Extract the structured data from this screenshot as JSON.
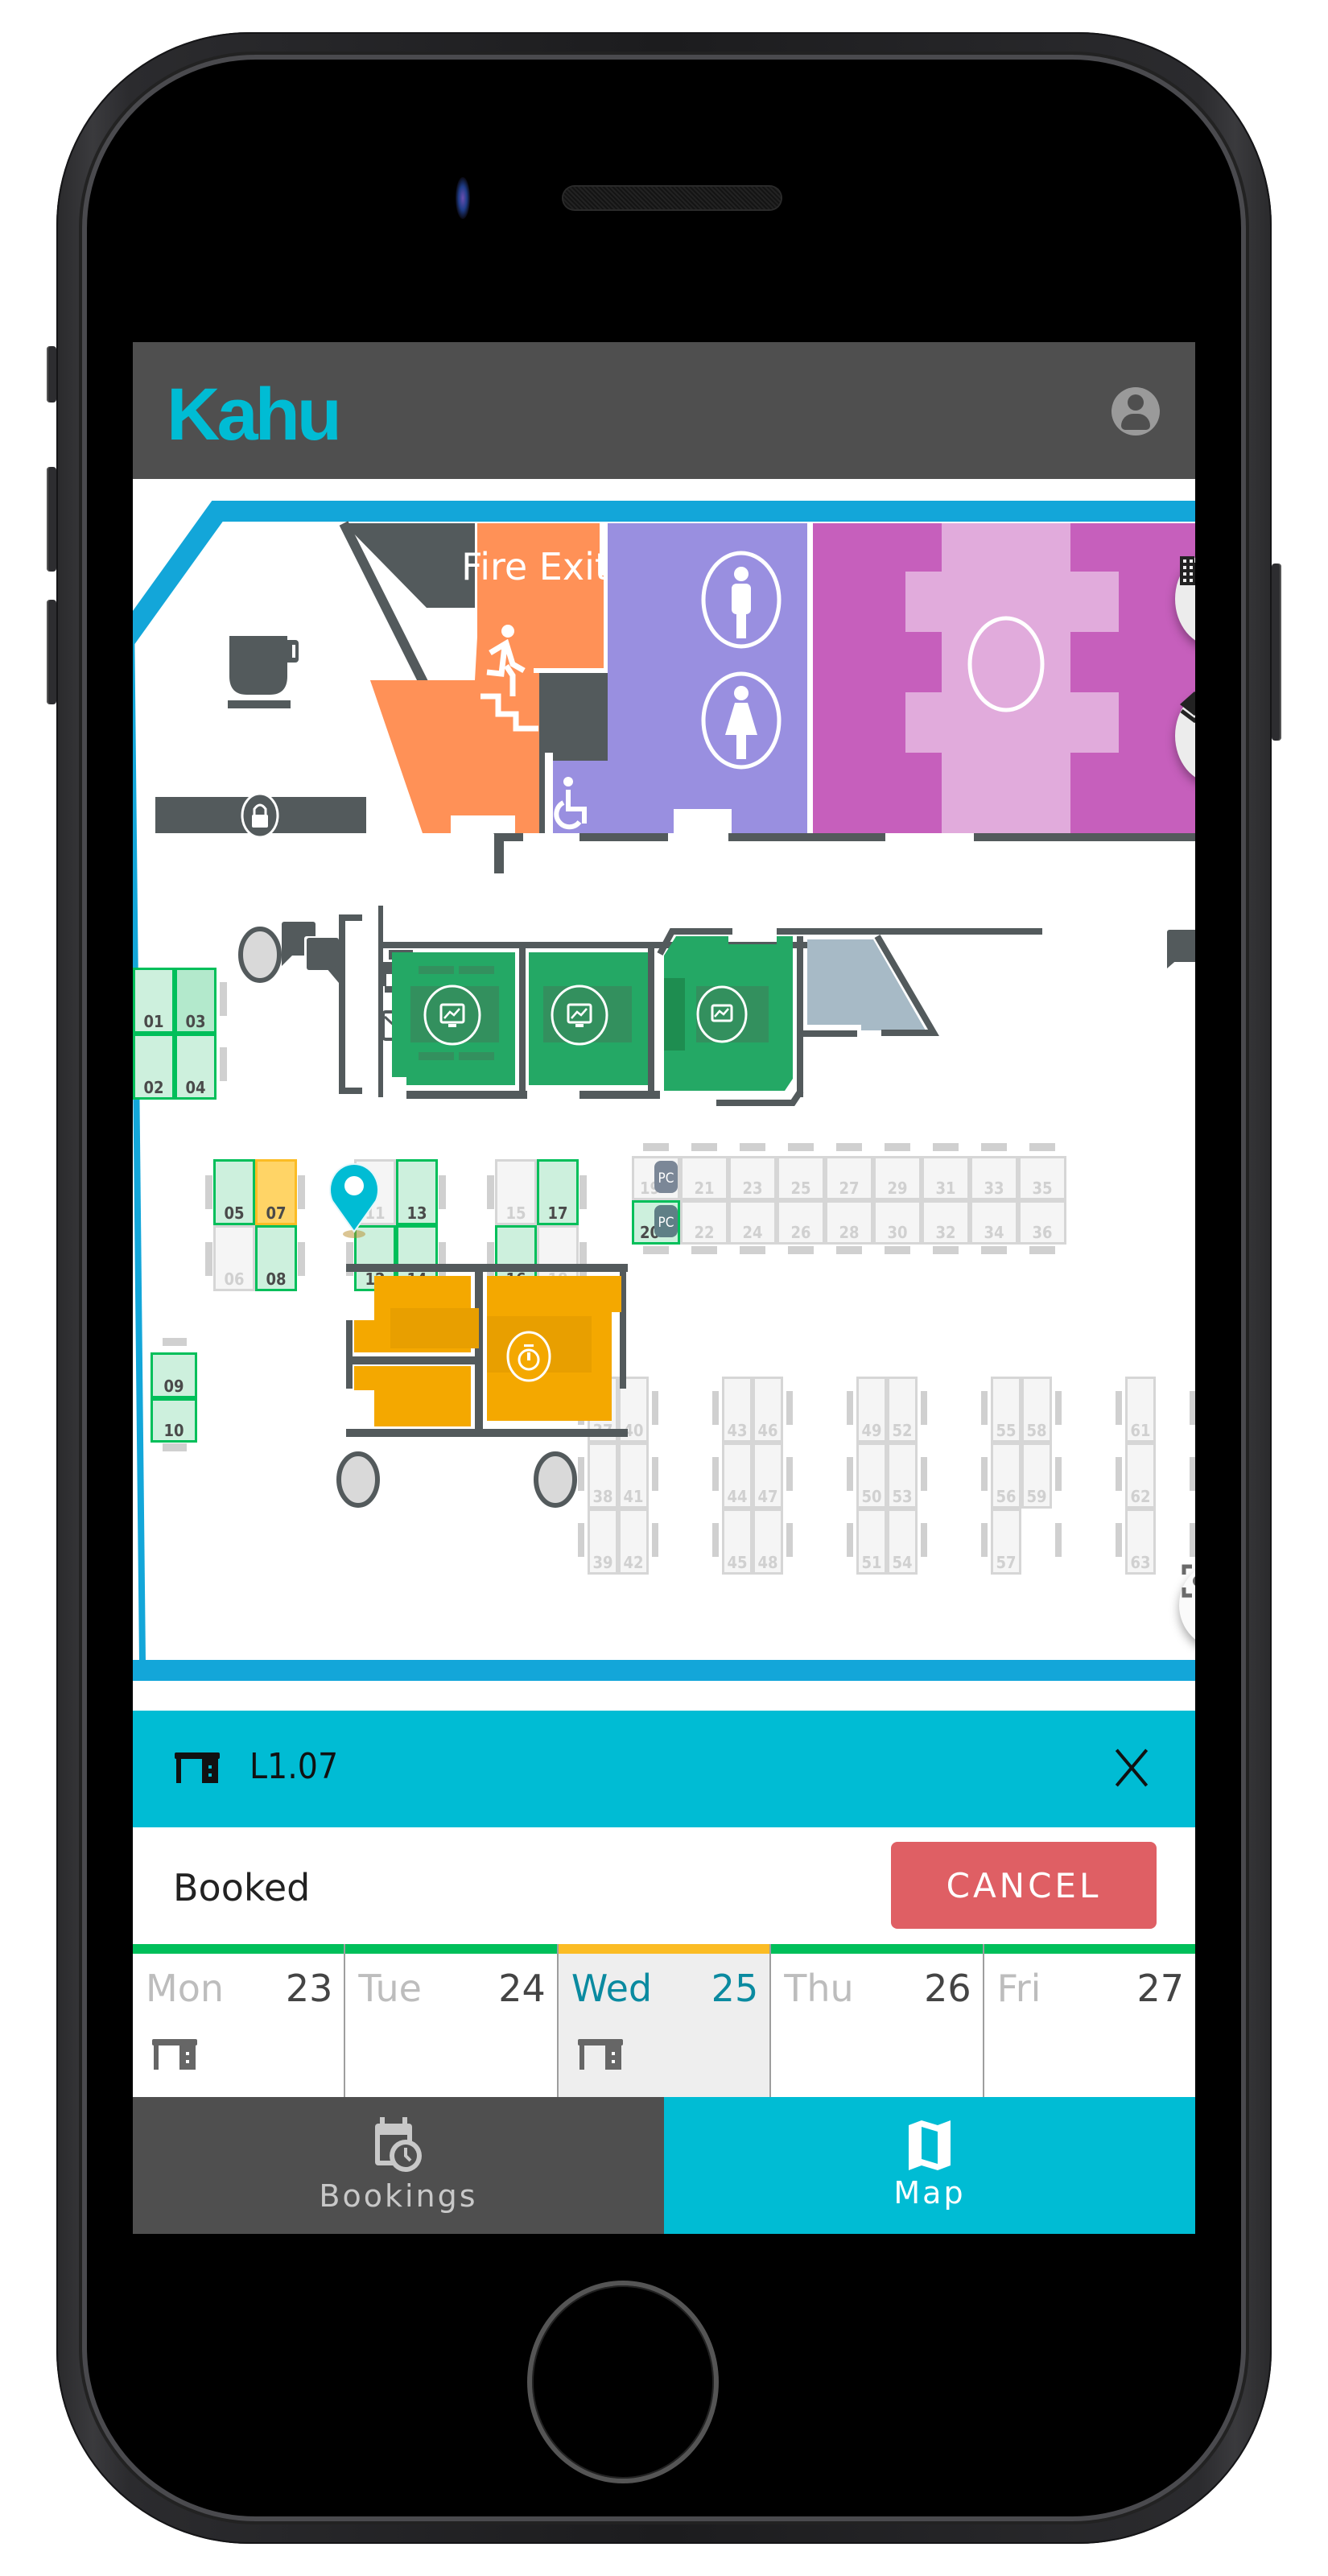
{
  "app": {
    "logo": "Kahu",
    "account_icon": "account-circle-icon"
  },
  "map": {
    "rooms": {
      "fire_exit_label": "Fire Exit"
    },
    "pc_badge": "PC",
    "desks": [
      {
        "id": "01",
        "status": "available"
      },
      {
        "id": "02",
        "status": "available"
      },
      {
        "id": "03",
        "status": "available-selected"
      },
      {
        "id": "04",
        "status": "available"
      },
      {
        "id": "05",
        "status": "available"
      },
      {
        "id": "06",
        "status": "unavailable"
      },
      {
        "id": "07",
        "status": "booked"
      },
      {
        "id": "08",
        "status": "available"
      },
      {
        "id": "09",
        "status": "available"
      },
      {
        "id": "10",
        "status": "available"
      },
      {
        "id": "11",
        "status": "unavailable"
      },
      {
        "id": "12",
        "status": "available"
      },
      {
        "id": "13",
        "status": "available"
      },
      {
        "id": "14",
        "status": "available"
      },
      {
        "id": "15",
        "status": "unavailable"
      },
      {
        "id": "16",
        "status": "available"
      },
      {
        "id": "17",
        "status": "available"
      },
      {
        "id": "18",
        "status": "unavailable"
      },
      {
        "id": "19",
        "status": "unavailable",
        "pc": true
      },
      {
        "id": "20",
        "status": "available",
        "pc": true
      },
      {
        "id": "21",
        "status": "unavailable"
      },
      {
        "id": "22",
        "status": "unavailable"
      },
      {
        "id": "23",
        "status": "unavailable"
      },
      {
        "id": "24",
        "status": "unavailable"
      },
      {
        "id": "25",
        "status": "unavailable"
      },
      {
        "id": "26",
        "status": "unavailable"
      },
      {
        "id": "27",
        "status": "unavailable"
      },
      {
        "id": "28",
        "status": "unavailable"
      },
      {
        "id": "29",
        "status": "unavailable"
      },
      {
        "id": "30",
        "status": "unavailable"
      },
      {
        "id": "31",
        "status": "unavailable"
      },
      {
        "id": "32",
        "status": "unavailable"
      },
      {
        "id": "33",
        "status": "unavailable"
      },
      {
        "id": "34",
        "status": "unavailable"
      },
      {
        "id": "35",
        "status": "unavailable"
      },
      {
        "id": "36",
        "status": "unavailable"
      },
      {
        "id": "37",
        "status": "unavailable"
      },
      {
        "id": "38",
        "status": "unavailable"
      },
      {
        "id": "39",
        "status": "unavailable"
      },
      {
        "id": "40",
        "status": "unavailable"
      },
      {
        "id": "41",
        "status": "unavailable"
      },
      {
        "id": "42",
        "status": "unavailable"
      },
      {
        "id": "43",
        "status": "unavailable"
      },
      {
        "id": "44",
        "status": "unavailable"
      },
      {
        "id": "45",
        "status": "unavailable"
      },
      {
        "id": "46",
        "status": "unavailable"
      },
      {
        "id": "47",
        "status": "unavailable"
      },
      {
        "id": "48",
        "status": "unavailable"
      },
      {
        "id": "49",
        "status": "unavailable"
      },
      {
        "id": "50",
        "status": "unavailable"
      },
      {
        "id": "51",
        "status": "unavailable"
      },
      {
        "id": "52",
        "status": "unavailable"
      },
      {
        "id": "53",
        "status": "unavailable"
      },
      {
        "id": "54",
        "status": "unavailable"
      },
      {
        "id": "55",
        "status": "unavailable"
      },
      {
        "id": "56",
        "status": "unavailable"
      },
      {
        "id": "57",
        "status": "unavailable"
      },
      {
        "id": "58",
        "status": "unavailable"
      },
      {
        "id": "59",
        "status": "unavailable"
      },
      {
        "id": "61",
        "status": "unavailable"
      },
      {
        "id": "62",
        "status": "unavailable"
      },
      {
        "id": "63",
        "status": "unavailable"
      }
    ],
    "controls": {
      "building_button": "building-icon",
      "layers_button": "layers-icon",
      "recenter_button": "center-focus-icon"
    }
  },
  "sheet": {
    "desk_name": "L1.07",
    "status": "Booked",
    "cancel_label": "CANCEL"
  },
  "days": [
    {
      "name": "Mon",
      "num": "23",
      "has_booking": true,
      "bar": "#00bf5a",
      "active": false
    },
    {
      "name": "Tue",
      "num": "24",
      "has_booking": false,
      "bar": "#00bf5a",
      "active": false
    },
    {
      "name": "Wed",
      "num": "25",
      "has_booking": true,
      "bar": "#fbbc24",
      "active": true
    },
    {
      "name": "Thu",
      "num": "26",
      "has_booking": false,
      "bar": "#00bf5a",
      "active": false
    },
    {
      "name": "Fri",
      "num": "27",
      "has_booking": false,
      "bar": "#00bf5a",
      "active": false
    }
  ],
  "tabs": [
    {
      "label": "Bookings",
      "icon": "calendar-clock-icon",
      "active": false
    },
    {
      "label": "Map",
      "icon": "map-icon",
      "active": true
    }
  ],
  "colors": {
    "accent": "#00bcd4",
    "header": "#4f4f4f",
    "cancel": "#df5f64",
    "available": "#cdf0dd",
    "available_border": "#00bf5a",
    "booked": "#ffd466",
    "meeting_room": "#24a865",
    "fire_exit": "#ff9157",
    "restroom": "#998fe0",
    "stairs": "#c65fbc",
    "busy_room": "#f4a800"
  }
}
